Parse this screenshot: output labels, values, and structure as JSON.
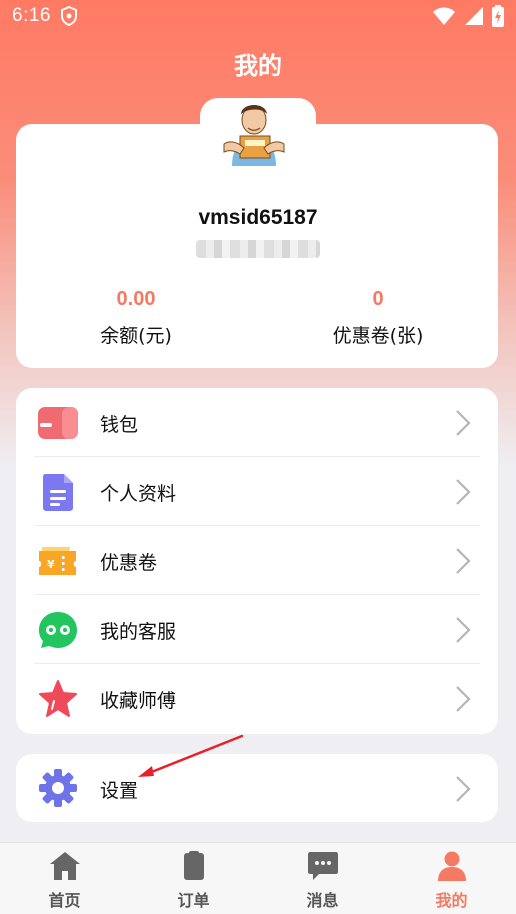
{
  "status_bar": {
    "time": "6:16"
  },
  "page": {
    "title": "我的"
  },
  "profile": {
    "username": "vmsid65187",
    "balance_value": "0.00",
    "balance_label": "余额(元)",
    "coupon_value": "0",
    "coupon_label": "优惠卷(张)"
  },
  "menu": {
    "items": [
      {
        "label": "钱包",
        "icon": "wallet-icon"
      },
      {
        "label": "个人资料",
        "icon": "document-icon"
      },
      {
        "label": "优惠卷",
        "icon": "coupon-icon"
      },
      {
        "label": "我的客服",
        "icon": "chat-bubble-icon"
      },
      {
        "label": "收藏师傅",
        "icon": "star-icon"
      }
    ]
  },
  "settings": {
    "label": "设置",
    "icon": "gear-icon"
  },
  "bottom_nav": {
    "items": [
      {
        "label": "首页",
        "icon": "home-icon"
      },
      {
        "label": "订单",
        "icon": "order-icon"
      },
      {
        "label": "消息",
        "icon": "message-icon"
      },
      {
        "label": "我的",
        "icon": "person-icon"
      }
    ],
    "active_index": 3
  },
  "colors": {
    "accent": "#f57a63",
    "header_gradient_top": "#ff7a63",
    "background": "#efeff3",
    "annotation_arrow": "#e8202a"
  }
}
